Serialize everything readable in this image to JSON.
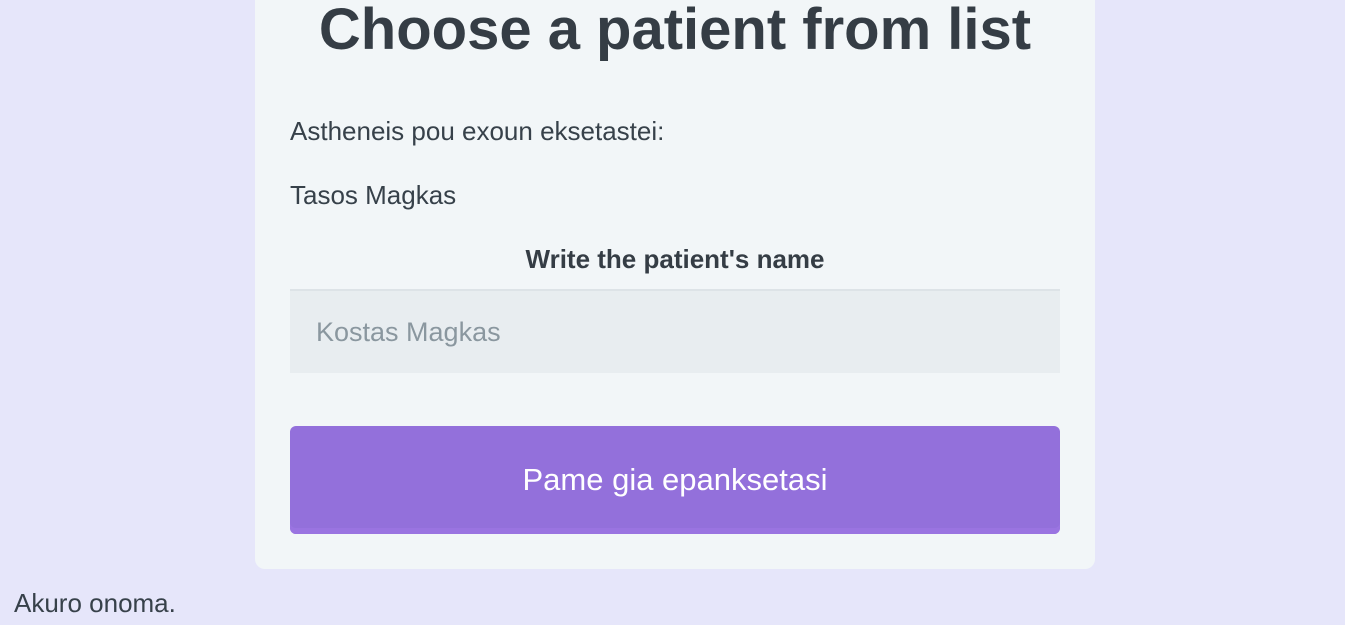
{
  "card": {
    "title": "Choose a patient from list",
    "examined_label": "Astheneis pou exoun eksetastei:",
    "patients": [
      "Tasos Magkas"
    ],
    "name_field_label": "Write the patient's name",
    "name_input": {
      "placeholder": "Kostas Magkas",
      "value": ""
    },
    "submit_label": "Pame gia epanksetasi"
  },
  "footer": {
    "message": "Akuro onoma."
  },
  "colors": {
    "page_background": "#e6e6fa",
    "card_background": "#f2f6f8",
    "button_background": "#9370db",
    "text": "#37414a"
  }
}
